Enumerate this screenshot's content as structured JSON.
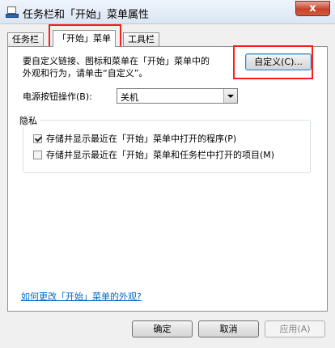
{
  "window": {
    "title": "任务栏和「开始」菜单属性",
    "close_label": "x"
  },
  "tabs": [
    {
      "label": "任务栏",
      "active": false
    },
    {
      "label": "「开始」菜单",
      "active": true
    },
    {
      "label": "工具栏",
      "active": false
    }
  ],
  "start_menu": {
    "intro_line1": "要自定义链接、图标和菜单在「开始」菜单中的",
    "intro_line2": "外观和行为，请单击“自定义”。",
    "customize_button": "自定义(C)...",
    "power_label": "电源按钮操作(B):",
    "power_value": "关机",
    "privacy": {
      "title": "隐私",
      "option1_label": "存储并显示最近在「开始」菜单中打开的程序(P)",
      "option1_checked": true,
      "option2_label": "存储并显示最近在「开始」菜单和任务栏中打开的项目(M)",
      "option2_checked": false
    },
    "help_link": "如何更改「开始」菜单的外观?"
  },
  "footer": {
    "ok_label": "确定",
    "cancel_label": "取消",
    "apply_label": "应用(A)"
  },
  "colors": {
    "highlight": "#ff1a1a",
    "link": "#0066cc"
  }
}
